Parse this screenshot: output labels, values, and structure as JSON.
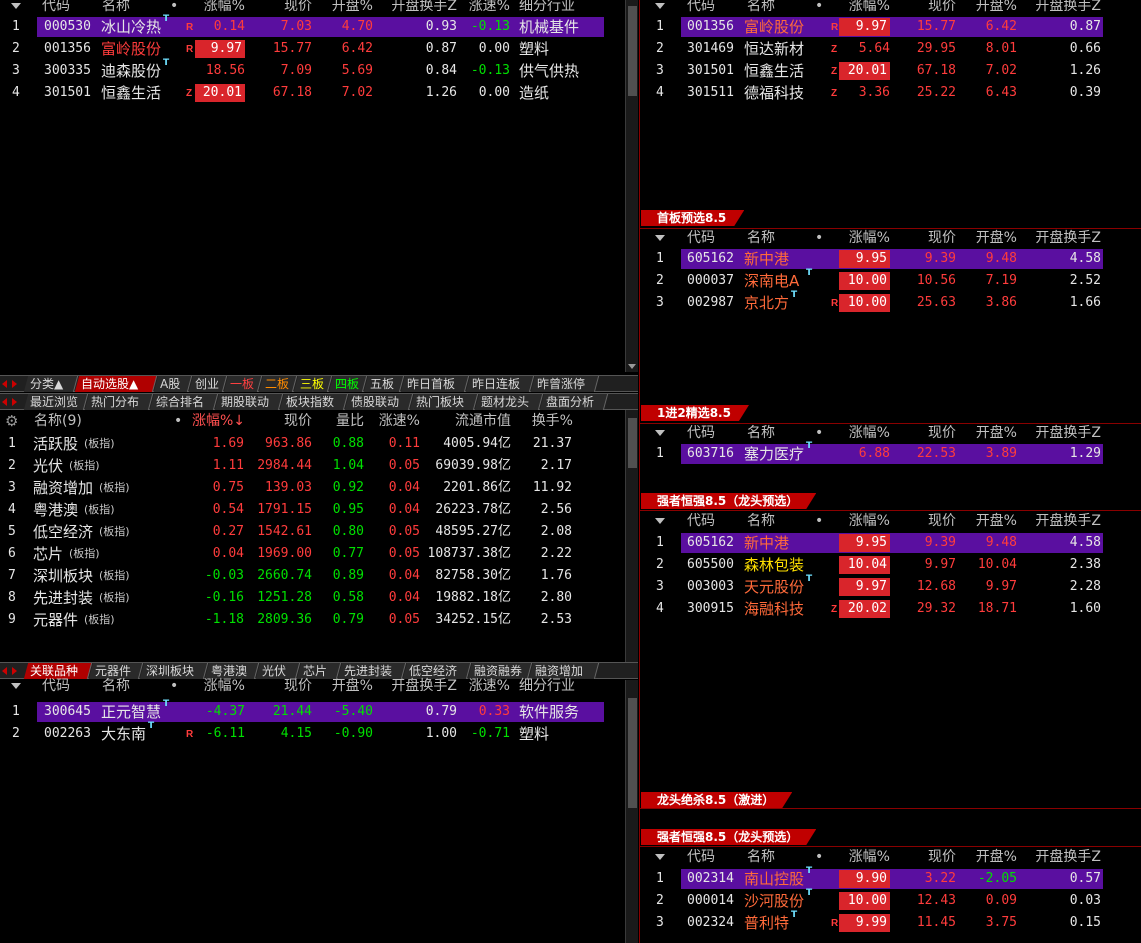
{
  "top_left": {
    "headers": [
      "代码",
      "名称",
      "•",
      "涨幅%",
      "现价",
      "开盘%",
      "开盘换手Z",
      "涨速%",
      "细分行业"
    ],
    "rows": [
      {
        "n": "1",
        "code": "000530",
        "name": "冰山冷热",
        "t": true,
        "flag": "R",
        "chg": "0.14",
        "price": "7.03",
        "open": "4.70",
        "turn": "0.93",
        "speed": "-0.13",
        "ind": "机械基件",
        "hl": true,
        "chg_bar": false,
        "name_color": "wht"
      },
      {
        "n": "2",
        "code": "001356",
        "name": "富岭股份",
        "t": false,
        "flag": "R",
        "chg": "9.97",
        "price": "15.77",
        "open": "6.42",
        "turn": "0.87",
        "speed": "0.00",
        "ind": "塑料",
        "hl": false,
        "chg_bar": true,
        "name_color": "red"
      },
      {
        "n": "3",
        "code": "300335",
        "name": "迪森股份",
        "t": true,
        "flag": "",
        "chg": "18.56",
        "price": "7.09",
        "open": "5.69",
        "turn": "0.84",
        "speed": "-0.13",
        "ind": "供气供热",
        "hl": false,
        "chg_bar": false,
        "name_color": "wht"
      },
      {
        "n": "4",
        "code": "301501",
        "name": "恒鑫生活",
        "t": false,
        "flag": "Z",
        "chg": "20.01",
        "price": "67.18",
        "open": "7.02",
        "turn": "1.26",
        "speed": "0.00",
        "ind": "造纸",
        "hl": false,
        "chg_bar": true,
        "name_color": "wht"
      }
    ]
  },
  "tabs1": [
    "分类▲",
    "自动选股▲",
    "A股",
    "创业",
    "一板",
    "二板",
    "三板",
    "四板",
    "五板",
    "昨日首板",
    "昨日连板",
    "昨曾涨停"
  ],
  "tabs2": [
    "最近浏览",
    "热门分布",
    "综合排名",
    "期股联动",
    "板块指数",
    "债股联动",
    "热门板块",
    "题材龙头",
    "盘面分析"
  ],
  "sector": {
    "headers": [
      "名称(9)",
      "•",
      "涨幅%↓",
      "现价",
      "量比",
      "涨速%",
      "流通市值",
      "换手%"
    ],
    "tag": "(板指)",
    "rows": [
      {
        "n": "1",
        "name": "活跃股",
        "chg": "1.69",
        "price": "963.86",
        "vr": "0.88",
        "speed": "0.11",
        "cap": "4005.94亿",
        "turn": "21.37",
        "neg": false
      },
      {
        "n": "2",
        "name": "光伏",
        "chg": "1.11",
        "price": "2984.44",
        "vr": "1.04",
        "speed": "0.05",
        "cap": "69039.98亿",
        "turn": "2.17",
        "neg": false
      },
      {
        "n": "3",
        "name": "融资增加",
        "chg": "0.75",
        "price": "139.03",
        "vr": "0.92",
        "speed": "0.04",
        "cap": "2201.86亿",
        "turn": "11.92",
        "neg": false
      },
      {
        "n": "4",
        "name": "粤港澳",
        "chg": "0.54",
        "price": "1791.15",
        "vr": "0.95",
        "speed": "0.04",
        "cap": "26223.78亿",
        "turn": "2.56",
        "neg": false
      },
      {
        "n": "5",
        "name": "低空经济",
        "chg": "0.27",
        "price": "1542.61",
        "vr": "0.80",
        "speed": "0.05",
        "cap": "48595.27亿",
        "turn": "2.08",
        "neg": false
      },
      {
        "n": "6",
        "name": "芯片",
        "chg": "0.04",
        "price": "1969.00",
        "vr": "0.77",
        "speed": "0.05",
        "cap": "108737.38亿",
        "turn": "2.22",
        "neg": false
      },
      {
        "n": "7",
        "name": "深圳板块",
        "chg": "-0.03",
        "price": "2660.74",
        "vr": "0.89",
        "speed": "0.04",
        "cap": "82758.30亿",
        "turn": "1.76",
        "neg": true
      },
      {
        "n": "8",
        "name": "先进封装",
        "chg": "-0.16",
        "price": "1251.28",
        "vr": "0.58",
        "speed": "0.04",
        "cap": "19882.18亿",
        "turn": "2.80",
        "neg": true
      },
      {
        "n": "9",
        "name": "元器件",
        "chg": "-1.18",
        "price": "2809.36",
        "vr": "0.79",
        "speed": "0.05",
        "cap": "34252.15亿",
        "turn": "2.53",
        "neg": true
      }
    ]
  },
  "tabs3": [
    "关联品种",
    "元器件",
    "深圳板块",
    "粤港澳",
    "光伏",
    "芯片",
    "先进封装",
    "低空经济",
    "融资融券",
    "融资增加"
  ],
  "bottom_left": {
    "headers": [
      "代码",
      "名称",
      "•",
      "涨幅%",
      "现价",
      "开盘%",
      "开盘换手Z",
      "涨速%",
      "细分行业"
    ],
    "rows": [
      {
        "n": "1",
        "code": "300645",
        "name": "正元智慧",
        "t": true,
        "flag": "",
        "chg": "-4.37",
        "price": "21.44",
        "open": "-5.40",
        "turn": "0.79",
        "speed": "0.33",
        "ind": "软件服务",
        "hl": true
      },
      {
        "n": "2",
        "code": "002263",
        "name": "大东南",
        "t": true,
        "flag": "R",
        "chg": "-6.11",
        "price": "4.15",
        "open": "-0.90",
        "turn": "1.00",
        "speed": "-0.71",
        "ind": "塑料",
        "hl": false
      }
    ]
  },
  "right_headers": [
    "代码",
    "名称",
    "•",
    "涨幅%",
    "现价",
    "开盘%",
    "开盘换手Z"
  ],
  "r1": {
    "rows": [
      {
        "n": "1",
        "code": "001356",
        "name": "富岭股份",
        "t": false,
        "flag": "R",
        "chg": "9.97",
        "price": "15.77",
        "open": "6.42",
        "turn": "0.87",
        "hl": true,
        "bar": true,
        "nc": "org"
      },
      {
        "n": "2",
        "code": "301469",
        "name": "恒达新材",
        "t": false,
        "flag": "Z",
        "chg": "5.64",
        "price": "29.95",
        "open": "8.01",
        "turn": "0.66",
        "hl": false,
        "bar": false,
        "nc": "wht"
      },
      {
        "n": "3",
        "code": "301501",
        "name": "恒鑫生活",
        "t": false,
        "flag": "Z",
        "chg": "20.01",
        "price": "67.18",
        "open": "7.02",
        "turn": "1.26",
        "hl": false,
        "bar": true,
        "nc": "wht"
      },
      {
        "n": "4",
        "code": "301511",
        "name": "德福科技",
        "t": false,
        "flag": "Z",
        "chg": "3.36",
        "price": "25.22",
        "open": "6.43",
        "turn": "0.39",
        "hl": false,
        "bar": false,
        "nc": "wht"
      }
    ]
  },
  "r2": {
    "title": "首板预选8.5",
    "rows": [
      {
        "n": "1",
        "code": "605162",
        "name": "新中港",
        "t": false,
        "flag": "",
        "chg": "9.95",
        "price": "9.39",
        "open": "9.48",
        "turn": "4.58",
        "hl": true,
        "bar": true,
        "nc": "org"
      },
      {
        "n": "2",
        "code": "000037",
        "name": "深南电A",
        "t": true,
        "flag": "",
        "chg": "10.00",
        "price": "10.56",
        "open": "7.19",
        "turn": "2.52",
        "hl": false,
        "bar": true,
        "nc": "org"
      },
      {
        "n": "3",
        "code": "002987",
        "name": "京北方",
        "t": true,
        "flag": "R",
        "chg": "10.00",
        "price": "25.63",
        "open": "3.86",
        "turn": "1.66",
        "hl": false,
        "bar": true,
        "nc": "org"
      }
    ]
  },
  "r3": {
    "title": "1进2精选8.5",
    "rows": [
      {
        "n": "1",
        "code": "603716",
        "name": "塞力医疗",
        "t": true,
        "flag": "",
        "chg": "6.88",
        "price": "22.53",
        "open": "3.89",
        "turn": "1.29",
        "hl": true,
        "bar": false,
        "nc": "wht"
      }
    ]
  },
  "r4": {
    "title": "强者恒强8.5（龙头预选）",
    "rows": [
      {
        "n": "1",
        "code": "605162",
        "name": "新中港",
        "t": false,
        "flag": "",
        "chg": "9.95",
        "price": "9.39",
        "open": "9.48",
        "turn": "4.58",
        "hl": true,
        "bar": true,
        "nc": "org"
      },
      {
        "n": "2",
        "code": "605500",
        "name": "森林包装",
        "t": false,
        "flag": "",
        "chg": "10.04",
        "price": "9.97",
        "open": "10.04",
        "turn": "2.38",
        "hl": false,
        "bar": true,
        "nc": "ylw"
      },
      {
        "n": "3",
        "code": "003003",
        "name": "天元股份",
        "t": true,
        "flag": "",
        "chg": "9.97",
        "price": "12.68",
        "open": "9.97",
        "turn": "2.28",
        "hl": false,
        "bar": true,
        "nc": "org"
      },
      {
        "n": "4",
        "code": "300915",
        "name": "海融科技",
        "t": false,
        "flag": "Z",
        "chg": "20.02",
        "price": "29.32",
        "open": "18.71",
        "turn": "1.60",
        "hl": false,
        "bar": true,
        "nc": "org"
      }
    ]
  },
  "r5": {
    "title": "龙头绝杀8.5（激进）"
  },
  "r6": {
    "title": "强者恒强8.5（龙头预选）",
    "rows": [
      {
        "n": "1",
        "code": "002314",
        "name": "南山控股",
        "t": true,
        "flag": "",
        "chg": "9.90",
        "price": "3.22",
        "open": "-2.05",
        "turn": "0.57",
        "hl": true,
        "bar": true,
        "nc": "org"
      },
      {
        "n": "2",
        "code": "000014",
        "name": "沙河股份",
        "t": true,
        "flag": "",
        "chg": "10.00",
        "price": "12.43",
        "open": "0.09",
        "turn": "0.03",
        "hl": false,
        "bar": true,
        "nc": "org"
      },
      {
        "n": "3",
        "code": "002324",
        "name": "普利特",
        "t": true,
        "flag": "R",
        "chg": "9.99",
        "price": "11.45",
        "open": "3.75",
        "turn": "0.15",
        "hl": false,
        "bar": true,
        "nc": "org"
      }
    ]
  }
}
